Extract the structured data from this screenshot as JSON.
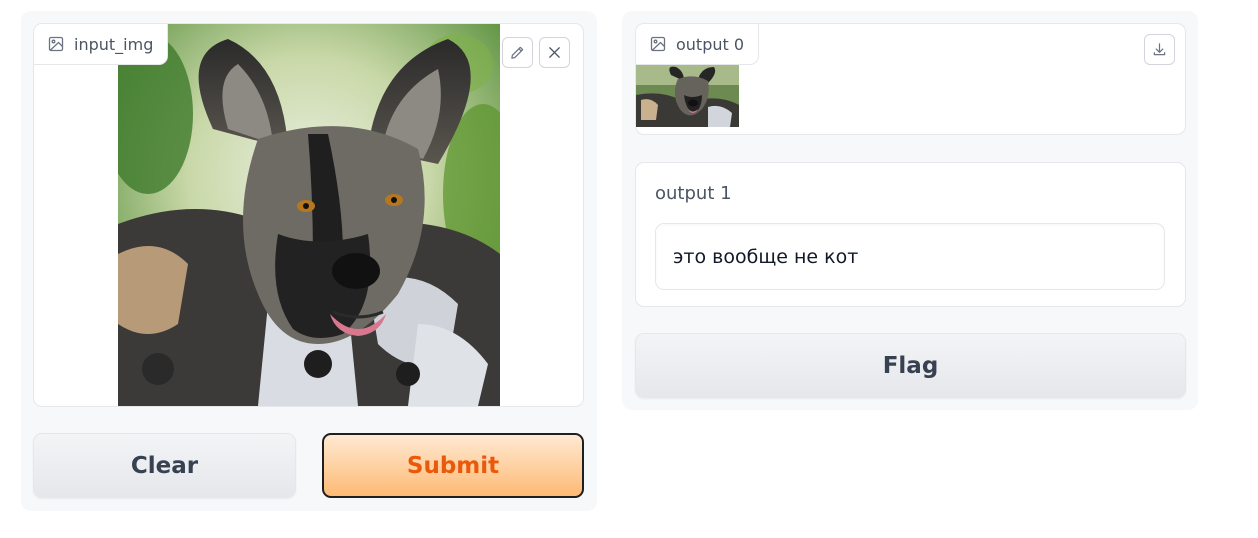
{
  "inputs": {
    "image_label": "input_img",
    "image_icon": "image-icon",
    "edit_icon": "pencil-icon",
    "clear_icon": "close-icon"
  },
  "outputs": {
    "image_label": "output 0",
    "image_icon": "image-icon",
    "download_icon": "download-icon",
    "text_label": "output 1",
    "text_value": "это вообще не кот"
  },
  "actions": {
    "clear_label": "Clear",
    "submit_label": "Submit",
    "flag_label": "Flag"
  },
  "colors": {
    "accent": "#ea580c",
    "primary_gradient_from": "#ffe9d2",
    "primary_gradient_to": "#fdba74",
    "panel_bg": "#f7f8fa",
    "border": "#e5e7eb"
  }
}
